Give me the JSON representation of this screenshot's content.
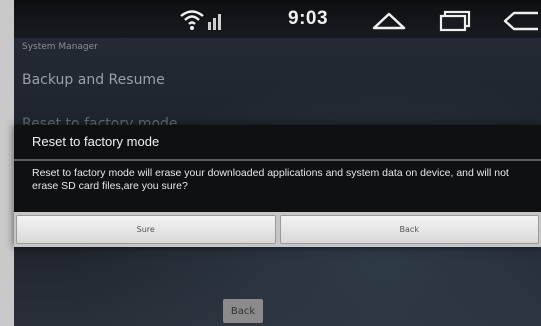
{
  "status_bar": {
    "time": "9:03",
    "icons": [
      "wifi-signal-icon",
      "home-icon",
      "recent-apps-icon",
      "back-icon"
    ]
  },
  "app": {
    "title": "System Manager",
    "menu_items": [
      "Backup and Resume",
      "Reset to factory mode",
      ""
    ],
    "back_button": "Back"
  },
  "dialog": {
    "title": "Reset to factory mode",
    "message": "Reset to factory mode will erase your downloaded applications and system data on device, and will not erase SD card files,are you sure?",
    "buttons": [
      "Sure",
      "Back"
    ]
  }
}
